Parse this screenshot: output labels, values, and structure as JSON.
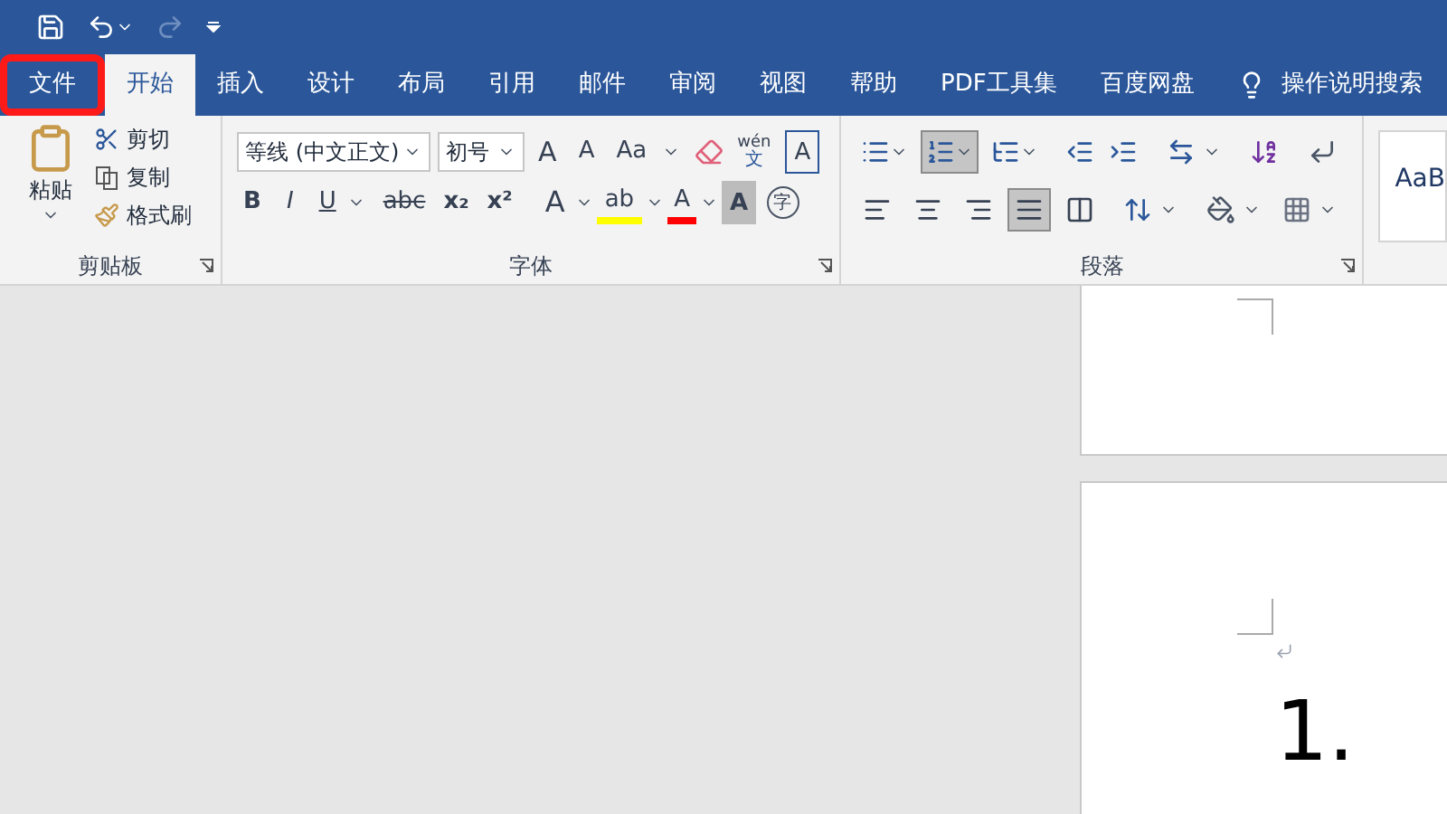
{
  "tabs": [
    {
      "label": "文件",
      "selected": false,
      "highlighted": true
    },
    {
      "label": "开始",
      "selected": true,
      "highlighted": false
    },
    {
      "label": "插入",
      "selected": false,
      "highlighted": false
    },
    {
      "label": "设计",
      "selected": false,
      "highlighted": false
    },
    {
      "label": "布局",
      "selected": false,
      "highlighted": false
    },
    {
      "label": "引用",
      "selected": false,
      "highlighted": false
    },
    {
      "label": "邮件",
      "selected": false,
      "highlighted": false
    },
    {
      "label": "审阅",
      "selected": false,
      "highlighted": false
    },
    {
      "label": "视图",
      "selected": false,
      "highlighted": false
    },
    {
      "label": "帮助",
      "selected": false,
      "highlighted": false
    },
    {
      "label": "PDF工具集",
      "selected": false,
      "highlighted": false
    },
    {
      "label": "百度网盘",
      "selected": false,
      "highlighted": false
    }
  ],
  "tell_me": "操作说明搜索",
  "clipboard": {
    "paste": "粘贴",
    "cut": "剪切",
    "copy": "复制",
    "format_painter": "格式刷",
    "label": "剪贴板"
  },
  "font": {
    "name": "等线 (中文正文)",
    "size": "初号",
    "case": "Aa",
    "phonetic": "wén",
    "phonetic_base": "文",
    "border_letter": "A",
    "bold": "B",
    "italic": "I",
    "underline": "U",
    "strike": "abc",
    "subscript": "x₂",
    "superscript": "x²",
    "effect_letter": "A",
    "highlight_letter": "ab",
    "color_letter": "A",
    "shading_letter": "A",
    "enclose": "字",
    "grow_letter": "A",
    "shrink_letter": "A",
    "label": "字体"
  },
  "paragraph": {
    "label": "段落",
    "list_buttons": [
      {
        "kind": "bullets",
        "pressed": false
      },
      {
        "kind": "numbering",
        "pressed": true
      },
      {
        "kind": "multilevel",
        "pressed": false
      }
    ],
    "align_buttons": [
      {
        "kind": "left",
        "pressed": false
      },
      {
        "kind": "center",
        "pressed": false
      },
      {
        "kind": "right",
        "pressed": false
      },
      {
        "kind": "justify",
        "pressed": true
      },
      {
        "kind": "distributed",
        "pressed": false
      }
    ]
  },
  "styles": {
    "preview": "AaB"
  },
  "document": {
    "list_number": "1."
  }
}
